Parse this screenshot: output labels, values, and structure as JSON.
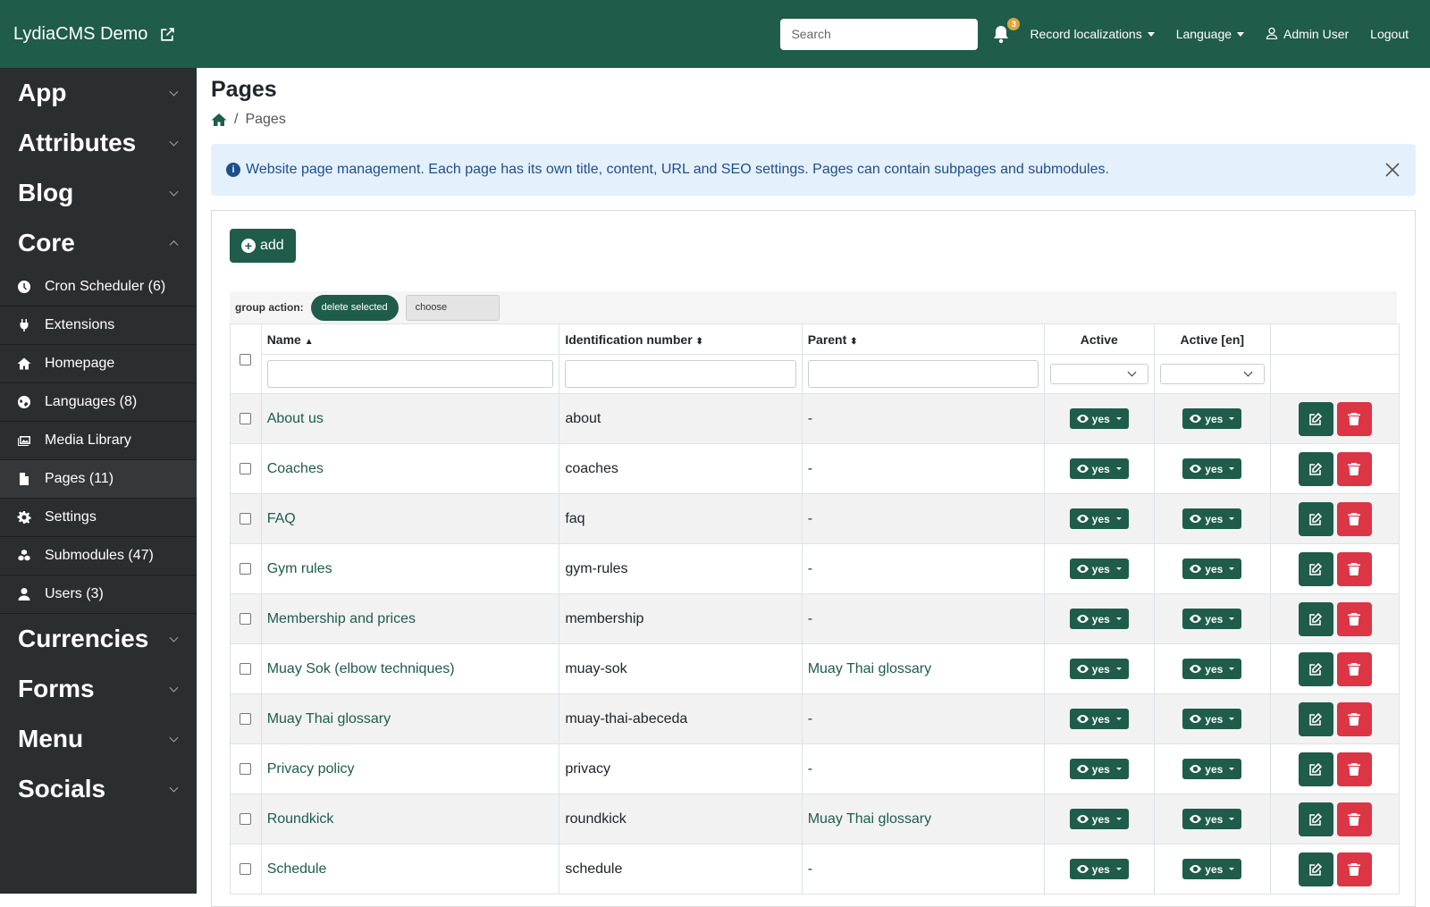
{
  "topbar": {
    "brand": "LydiaCMS Demo",
    "search_placeholder": "Search",
    "notifications_count": "3",
    "record_localizations": "Record localizations",
    "language": "Language",
    "user": "Admin User",
    "logout": "Logout"
  },
  "sidebar": {
    "groups_top": [
      {
        "label": "App"
      },
      {
        "label": "Attributes"
      },
      {
        "label": "Blog"
      },
      {
        "label": "Core"
      }
    ],
    "core_items": [
      {
        "label": "Cron Scheduler (6)",
        "icon": "clock-icon"
      },
      {
        "label": "Extensions",
        "icon": "plug-icon"
      },
      {
        "label": "Homepage",
        "icon": "home-icon"
      },
      {
        "label": "Languages (8)",
        "icon": "globe-icon"
      },
      {
        "label": "Media Library",
        "icon": "images-icon"
      },
      {
        "label": "Pages (11)",
        "icon": "file-icon"
      },
      {
        "label": "Settings",
        "icon": "gear-icon"
      },
      {
        "label": "Submodules (47)",
        "icon": "cubes-icon"
      },
      {
        "label": "Users (3)",
        "icon": "user-icon"
      }
    ],
    "groups_bottom": [
      {
        "label": "Currencies"
      },
      {
        "label": "Forms"
      },
      {
        "label": "Menu"
      },
      {
        "label": "Socials"
      }
    ]
  },
  "main": {
    "title": "Pages",
    "breadcrumb": "Pages",
    "alert": "Website page management. Each page has its own title, content, URL and SEO settings. Pages can contain subpages and submodules.",
    "add_label": "add",
    "group_action_label": "group action:",
    "delete_selected": "delete selected",
    "choose": "choose"
  },
  "table": {
    "headers": {
      "name": "Name",
      "ident": "Identification number",
      "parent": "Parent",
      "active": "Active",
      "active_en": "Active [en]"
    },
    "active_value": "yes",
    "rows": [
      {
        "name": "About us",
        "ident": "about",
        "parent": "-"
      },
      {
        "name": "Coaches",
        "ident": "coaches",
        "parent": "-"
      },
      {
        "name": "FAQ",
        "ident": "faq",
        "parent": "-"
      },
      {
        "name": "Gym rules",
        "ident": "gym-rules",
        "parent": "-"
      },
      {
        "name": "Membership and prices",
        "ident": "membership",
        "parent": "-"
      },
      {
        "name": "Muay Sok (elbow techniques)",
        "ident": "muay-sok",
        "parent": "Muay Thai glossary"
      },
      {
        "name": "Muay Thai glossary",
        "ident": "muay-thai-abeceda",
        "parent": "-"
      },
      {
        "name": "Privacy policy",
        "ident": "privacy",
        "parent": "-"
      },
      {
        "name": "Roundkick",
        "ident": "roundkick",
        "parent": "Muay Thai glossary"
      },
      {
        "name": "Schedule",
        "ident": "schedule",
        "parent": "-"
      }
    ]
  }
}
